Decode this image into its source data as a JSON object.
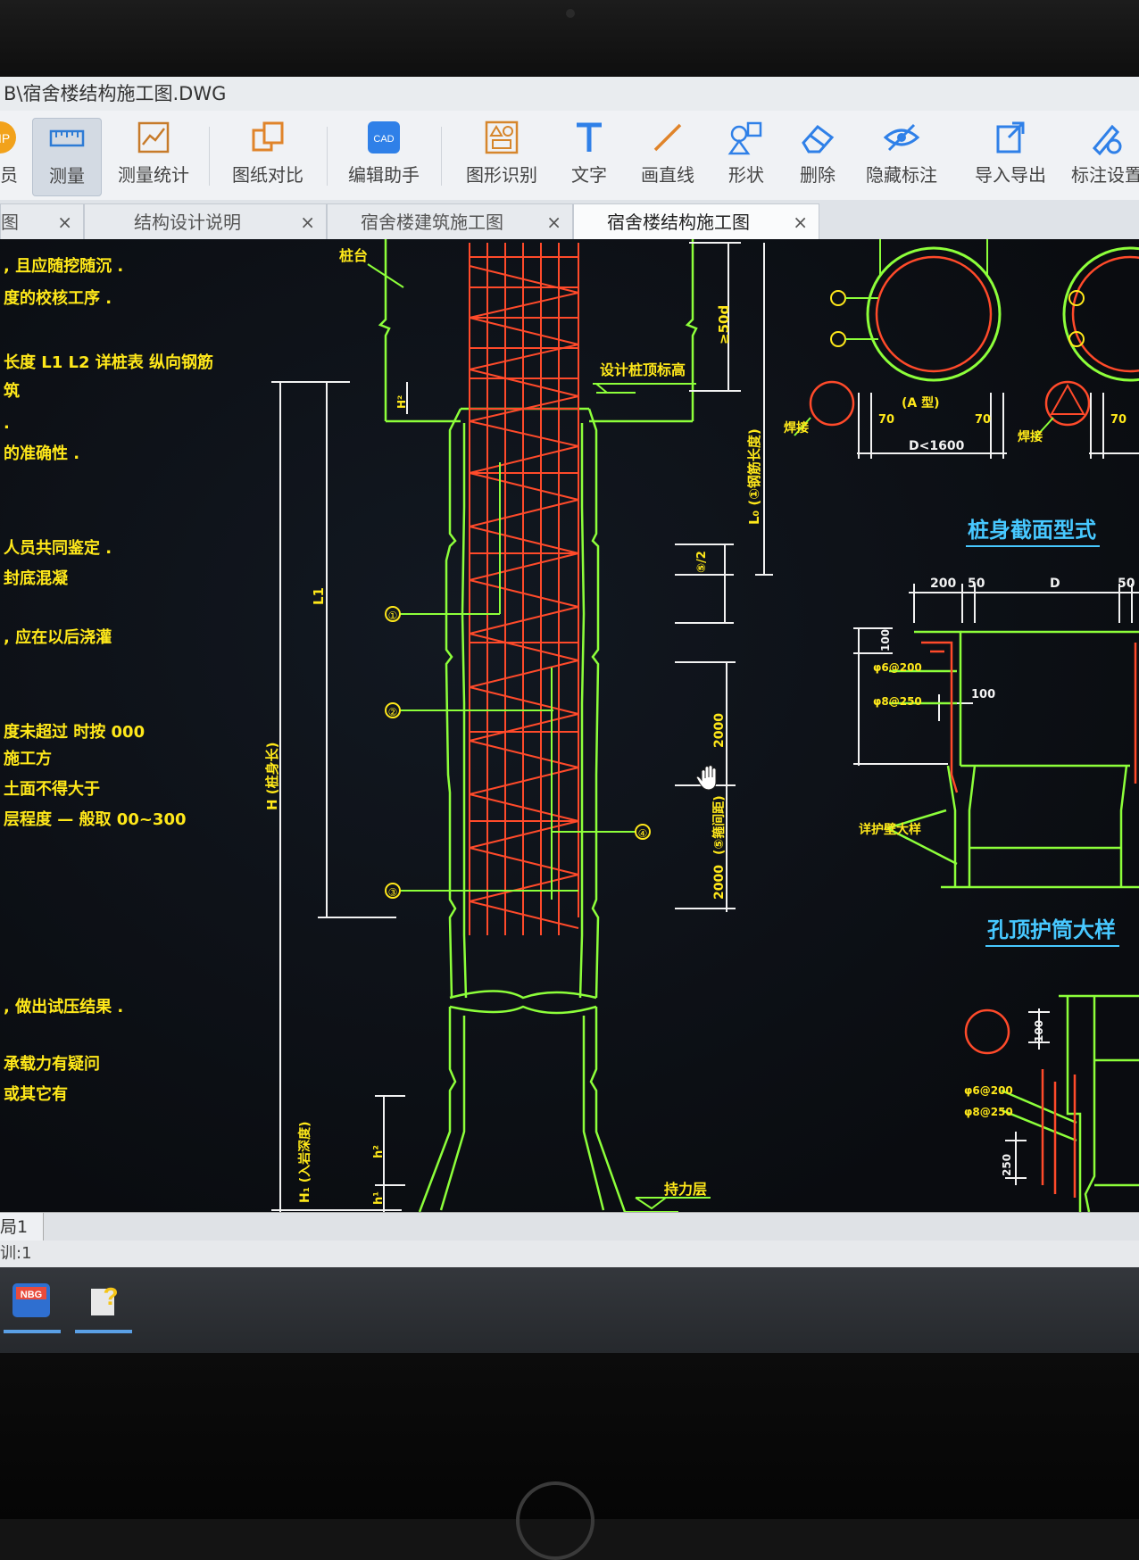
{
  "window": {
    "title": "B\\宿舍楼结构施工图.DWG"
  },
  "toolbar": {
    "items": [
      {
        "label": "员",
        "icon": "vip-icon"
      },
      {
        "label": "测量",
        "icon": "ruler-icon",
        "active": true
      },
      {
        "label": "测量统计",
        "icon": "measure-stats-icon"
      },
      {
        "label": "图纸对比",
        "icon": "compare-icon"
      },
      {
        "label": "编辑助手",
        "icon": "cad-assistant-icon"
      },
      {
        "label": "图形识别",
        "icon": "shape-recognize-icon"
      },
      {
        "label": "文字",
        "icon": "text-icon"
      },
      {
        "label": "画直线",
        "icon": "line-icon"
      },
      {
        "label": "形状",
        "icon": "shape-icon"
      },
      {
        "label": "删除",
        "icon": "eraser-icon"
      },
      {
        "label": "隐藏标注",
        "icon": "eye-hide-icon"
      },
      {
        "label": "导入导出",
        "icon": "import-export-icon"
      },
      {
        "label": "标注设置",
        "icon": "annotation-settings-icon"
      }
    ]
  },
  "tabs": [
    {
      "label": "图",
      "close": "×"
    },
    {
      "label": "结构设计说明",
      "close": "×"
    },
    {
      "label": "宿舍楼建筑施工图",
      "close": "×"
    },
    {
      "label": "宿舍楼结构施工图",
      "close": "×",
      "active": true
    }
  ],
  "notes": [
    ", 且应随挖随沉 .",
    "度的校核工序 .",
    "长度 L1 L2  详桩表  纵向钢筋",
    "筑",
    ".",
    "的准确性 .",
    "人员共同鉴定 .",
    "封底混凝",
    ", 应在以后浇灌",
    "度未超过  时按   000",
    "施工方",
    "土面不得大于",
    "层程度 — 般取 00~300",
    ", 做出试压结果 .",
    "承载力有疑问",
    "或其它有"
  ],
  "drawing": {
    "pile": {
      "label_cap": "桩台",
      "label_top_elev": "设计桩顶标高",
      "label_bearing": "持力层",
      "label_anchor": "≥50d",
      "label_l0": "L₀ (①钢筋长度)",
      "label_l1": "L1",
      "label_h_total": "H (桩身长)",
      "label_h1": "H₁ (入岩深度)",
      "label_spacing": "(⑤箍间距)",
      "dim_2000_a": "2000",
      "dim_2000_b": "2000",
      "label_h2": "h²",
      "label_h1_small": "h¹",
      "label_h_top": "H²",
      "label_dim_s": "⑤/2",
      "callouts": [
        "①",
        "②",
        "③",
        "④",
        "⑤"
      ]
    },
    "section": {
      "title": "桩身截面型式",
      "type_label": "(A 型)",
      "dim_70a": "70",
      "dim_70b": "70",
      "dim_70c": "70",
      "dim_d": "D<1600",
      "label_weld_a": "焊接",
      "label_weld_b": "焊接"
    },
    "collar": {
      "title": "孔顶护筒大样",
      "dim_200": "200",
      "dim_50a": "50",
      "dim_D": "D",
      "dim_50b": "50",
      "dim_100_left": "100",
      "dim_100": "100",
      "rebar_a": "φ6@200",
      "rebar_b": "φ8@250",
      "wall_label": "详护壁大样"
    },
    "detail": {
      "dim_100": "100",
      "rebar_a": "φ6@200",
      "rebar_b": "φ8@250",
      "dim_250": "250"
    }
  },
  "layout": {
    "tab": "局1"
  },
  "status": {
    "text": "训:1"
  },
  "taskbar": [
    {
      "label": "NBG计价",
      "icon": "nbg-pricing-icon"
    },
    {
      "label": "?",
      "icon": "help-file-icon"
    }
  ],
  "colors": {
    "cad_green": "#8dff3a",
    "cad_red": "#ff4a2a",
    "cad_yellow": "#ffe81a",
    "cad_white": "#f2f2f2",
    "cad_cyan": "#47c8ff"
  }
}
